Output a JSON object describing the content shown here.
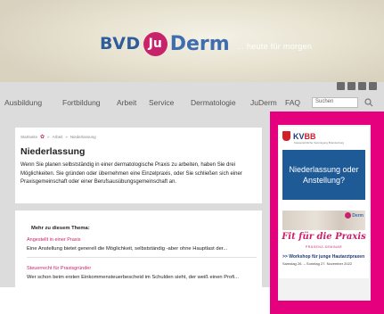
{
  "header": {
    "logo_bvd": "BVD",
    "logo_ju": "Ju",
    "logo_derm": "Derm",
    "tagline": "... heute für morgen"
  },
  "nav": {
    "items": [
      "Ausbildung",
      "Fortbildung",
      "Arbeit",
      "Service",
      "Dermatologie",
      "JuDerm",
      "FAQ"
    ],
    "search_placeholder": "Suchen"
  },
  "breadcrumb": [
    "Startseite",
    "Arbeit",
    "Niederlassung"
  ],
  "main": {
    "title": "Niederlassung",
    "intro": "Wenn Sie planen selbstständig in einer dermatologische Praxis zu arbeiten, haben Sie drei Möglichkeiten. Sie gründen oder übernehmen eine Einzelpraxis, oder Sie schließen sich einer Praxisgemeinschaft oder einer Berufsausübungsgemeinschaft an."
  },
  "more": {
    "title": "Mehr zu diesem Thema:",
    "items": [
      {
        "link": "Angestellt in einer Praxis",
        "text": "Eine Anstellung bietet generell die Möglichkeit, selbstständig -aber ohne Hauptlast der..."
      },
      {
        "link": "Steuerrecht für Praxisgründer",
        "text": "Wer schon beim ersten Einkommensteuerbescheid im Schulden sieht, der weiß einen Profi..."
      }
    ]
  },
  "sidebar": {
    "kv_name": "KV",
    "kv_name_bb": "BB",
    "kv_sub": "Kassenärztliche Vereinigung Brandenburg",
    "kv_banner": "Niederlassung oder Anstellung?",
    "ad_brand": "Derm",
    "ad_title": "Fit für die Praxis",
    "ad_sub": "PRÄSENZ-SEMINAR",
    "ad_line1": ">> Workshop für junge Hautarztpraxen",
    "ad_line2": "Samstag 26. – Sonntag 27. November 2022"
  },
  "colors": {
    "accent_pink": "#e5007e",
    "brand_blue": "#2e5d9a",
    "link_pink": "#c8236a"
  }
}
